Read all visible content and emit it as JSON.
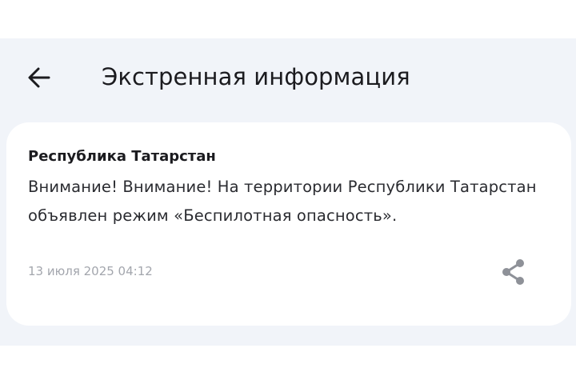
{
  "header": {
    "title": "Экстренная информация",
    "back_icon": "arrow-left-icon"
  },
  "alert": {
    "region": "Республика Татарстан",
    "message": "Внимание! Внимание! На территории Республики Татарстан объявлен режим «Беспилотная опасность».",
    "datetime": "13 июля 2025 04:12",
    "share_icon": "share-icon"
  },
  "colors": {
    "background": "#f1f4f9",
    "card": "#ffffff",
    "text": "#1b1b1f",
    "muted": "#a3a6ad",
    "icon": "#8e9198"
  }
}
